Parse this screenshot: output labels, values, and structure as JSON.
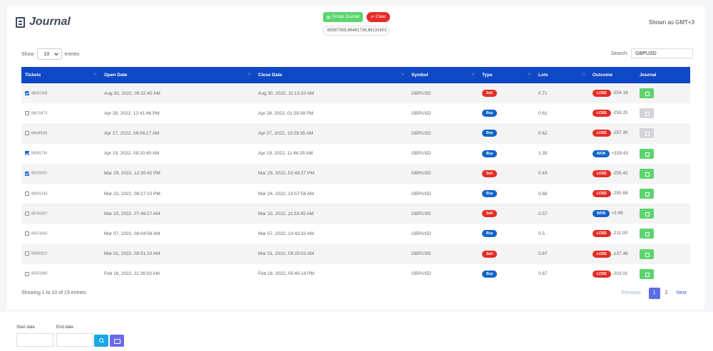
{
  "header": {
    "title": "Journal",
    "group_button": "Group Journal",
    "clear_button": "Clear",
    "selected_ids": "88387358,86481736,86131601",
    "timezone": "Shown as GMT+3"
  },
  "controls": {
    "show_label": "Show",
    "entries_value": "10",
    "entries_label": "entries",
    "search_label": "Search:",
    "search_value": "GBPUSD"
  },
  "table": {
    "columns": [
      "Tickets",
      "Open Date",
      "Close Date",
      "Symbol",
      "Type",
      "Lots",
      "Outcome",
      "Journal"
    ],
    "rows": [
      {
        "ticket": "88387358",
        "checked": true,
        "open": "Aug 30, 2022, 09:22:42 AM",
        "close": "Aug 30, 2022, 11:13:20 AM",
        "symbol": "GBPUSD",
        "type": "Sell",
        "lots": "0.71",
        "result": "LOSS",
        "amount": "-254.18",
        "journal": "green"
      },
      {
        "ticket": "86679473",
        "checked": false,
        "open": "Apr 28, 2022, 12:41:46 PM",
        "close": "Apr 28, 2022, 01:29:38 PM",
        "symbol": "GBPUSD",
        "type": "Buy",
        "lots": "0.61",
        "result": "LOSS",
        "amount": "-259.25",
        "journal": "gray"
      },
      {
        "ticket": "86640006",
        "checked": false,
        "open": "Apr 27, 2022, 08:08:17 AM",
        "close": "Apr 27, 2022, 10:29:35 AM",
        "symbol": "GBPUSD",
        "type": "Buy",
        "lots": "0.62",
        "result": "LOSS",
        "amount": "-257.30",
        "journal": "gray"
      },
      {
        "ticket": "86481736",
        "checked": true,
        "open": "Apr 19, 2022, 09:20:40 AM",
        "close": "Apr 19, 2022, 11:46:29 AM",
        "symbol": "GBPUSD",
        "type": "Buy",
        "lots": "1.39",
        "result": "WON",
        "amount": "+329.43",
        "journal": "green"
      },
      {
        "ticket": "86131601",
        "checked": true,
        "open": "Mar 29, 2022, 12:30:42 PM",
        "close": "Mar 29, 2022, 02:49:27 PM",
        "symbol": "GBPUSD",
        "type": "Sell",
        "lots": "0.43",
        "result": "LOSS",
        "amount": "-255.42",
        "journal": "green"
      },
      {
        "ticket": "86041244",
        "checked": false,
        "open": "Mar 23, 2022, 06:27:10 PM",
        "close": "Mar 24, 2022, 10:57:56 AM",
        "symbol": "GBPUSD",
        "type": "Buy",
        "lots": "0.68",
        "result": "LOSS",
        "amount": "-255.68",
        "journal": "green"
      },
      {
        "ticket": "85792407",
        "checked": false,
        "open": "Mar 10, 2022, 07:46:27 AM",
        "close": "Mar 10, 2022, 11:53:45 AM",
        "symbol": "GBPUSD",
        "type": "Sell",
        "lots": "0.57",
        "result": "WON",
        "amount": "+3.99",
        "journal": "green"
      },
      {
        "ticket": "85674260",
        "checked": false,
        "open": "Mar 07, 2022, 08:04:58 AM",
        "close": "Mar 07, 2022, 10:43:32 AM",
        "symbol": "GBPUSD",
        "type": "Buy",
        "lots": "0.5",
        "result": "LOSS",
        "amount": "-211.00",
        "journal": "green"
      },
      {
        "ticket": "85550912",
        "checked": false,
        "open": "Mar 01, 2022, 08:51:10 AM",
        "close": "Mar 01, 2022, 09:20:03 AM",
        "symbol": "GBPUSD",
        "type": "Sell",
        "lots": "0.87",
        "result": "LOSS",
        "amount": "-137.46",
        "journal": "green"
      },
      {
        "ticket": "85351889",
        "checked": false,
        "open": "Feb 18, 2022, 11:26:03 AM",
        "close": "Feb 18, 2022, 05:40:14 PM",
        "symbol": "GBPUSD",
        "type": "Buy",
        "lots": "0.67",
        "result": "LOSS",
        "amount": "-203.01",
        "journal": "green"
      }
    ]
  },
  "footer": {
    "info": "Showing 1 to 10 of 19 entries",
    "previous": "Previous",
    "page1": "1",
    "page2": "2",
    "next": "Next"
  },
  "filters": {
    "start_label": "Start date",
    "end_label": "End date"
  }
}
